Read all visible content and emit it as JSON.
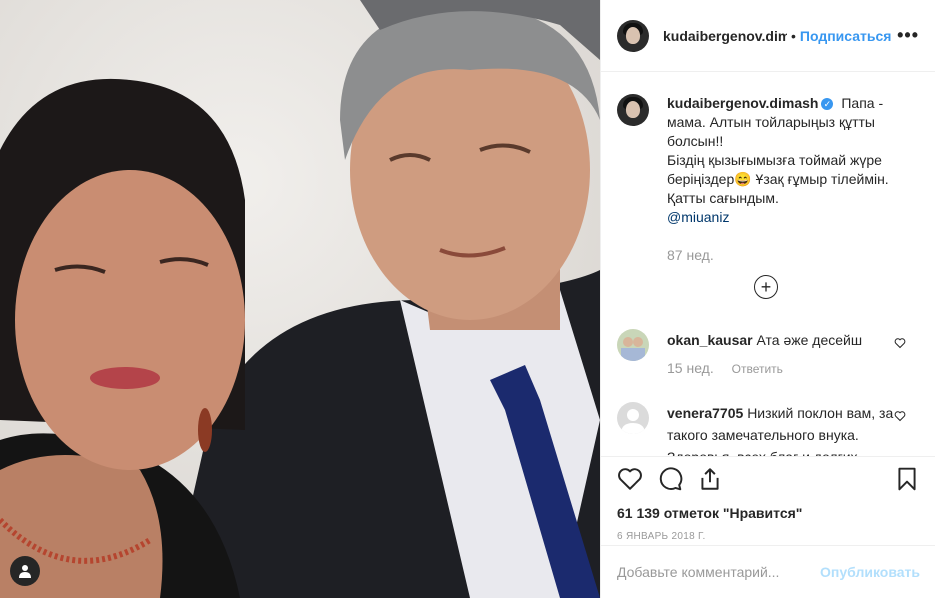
{
  "post": {
    "username": "kudaibergenov.dimash",
    "dot": "•",
    "follow_label": "Подписаться",
    "more_label": "•••"
  },
  "caption": {
    "username": "kudaibergenov.dimash",
    "verified_mark": "✓",
    "line1": "Папа - мама. Алтын тойларыңыз құтты болсын!!",
    "line2": "Біздің қызығымызға тоймай жүре беріңіздер😄 Ұзақ ғұмыр тілеймін. Қатты сағындым.",
    "mention": "@miuaniz",
    "time": "87 нед.",
    "load_more": "+"
  },
  "comments": [
    {
      "username": "okan_kausar",
      "text": "Ата әже десейш",
      "time": "15 нед.",
      "reply": "Ответить"
    },
    {
      "username": "venera7705",
      "text": "Низкий поклон вам, за такого замечательного внука. Здоровья, всех благ и долгих ,"
    }
  ],
  "likes": "61 139 отметок \"Нравится\"",
  "date": "6 январь 2018 г.",
  "add_comment": {
    "placeholder": "Добавьте комментарий...",
    "publish_label": "Опубликовать"
  }
}
